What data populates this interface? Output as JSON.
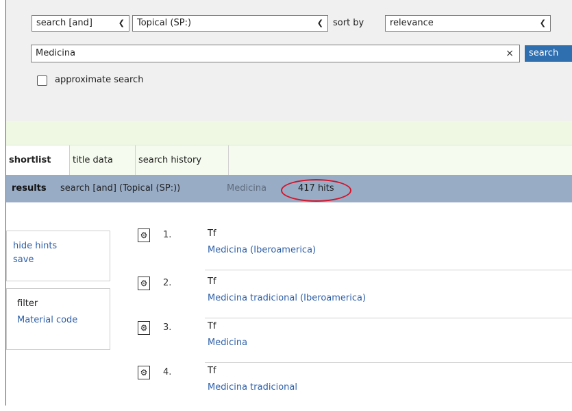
{
  "search": {
    "operator": "search [and]",
    "index": "Topical (SP:)",
    "sort_label": "sort by",
    "sort_value": "relevance",
    "query": "Medicina",
    "clear_glyph": "×",
    "button": "search",
    "approximate_label": "approximate search"
  },
  "tabs": [
    {
      "label": "shortlist",
      "active": true
    },
    {
      "label": "title data",
      "active": false
    },
    {
      "label": "search history",
      "active": false
    }
  ],
  "results_bar": {
    "label": "results",
    "query": "search [and]  (Topical (SP:))",
    "term": "Medicina",
    "hits": "417 hits",
    "highlight_color": "#d3152a"
  },
  "sidebar": {
    "hints": [
      "hide hints",
      "save"
    ],
    "filter_label": "filter",
    "filter_items": [
      "Material code"
    ]
  },
  "results": [
    {
      "num": "1.",
      "type": "Tf",
      "title": "Medicina (Iberoamerica)"
    },
    {
      "num": "2.",
      "type": "Tf",
      "title": "Medicina tradicional (Iberoamerica)"
    },
    {
      "num": "3.",
      "type": "Tf",
      "title": "Medicina"
    },
    {
      "num": "4.",
      "type": "Tf",
      "title": "Medicina tradicional"
    }
  ],
  "colors": {
    "accent": "#2f6fb0",
    "results_bar": "#98acc6",
    "link": "#2d5fa8"
  }
}
